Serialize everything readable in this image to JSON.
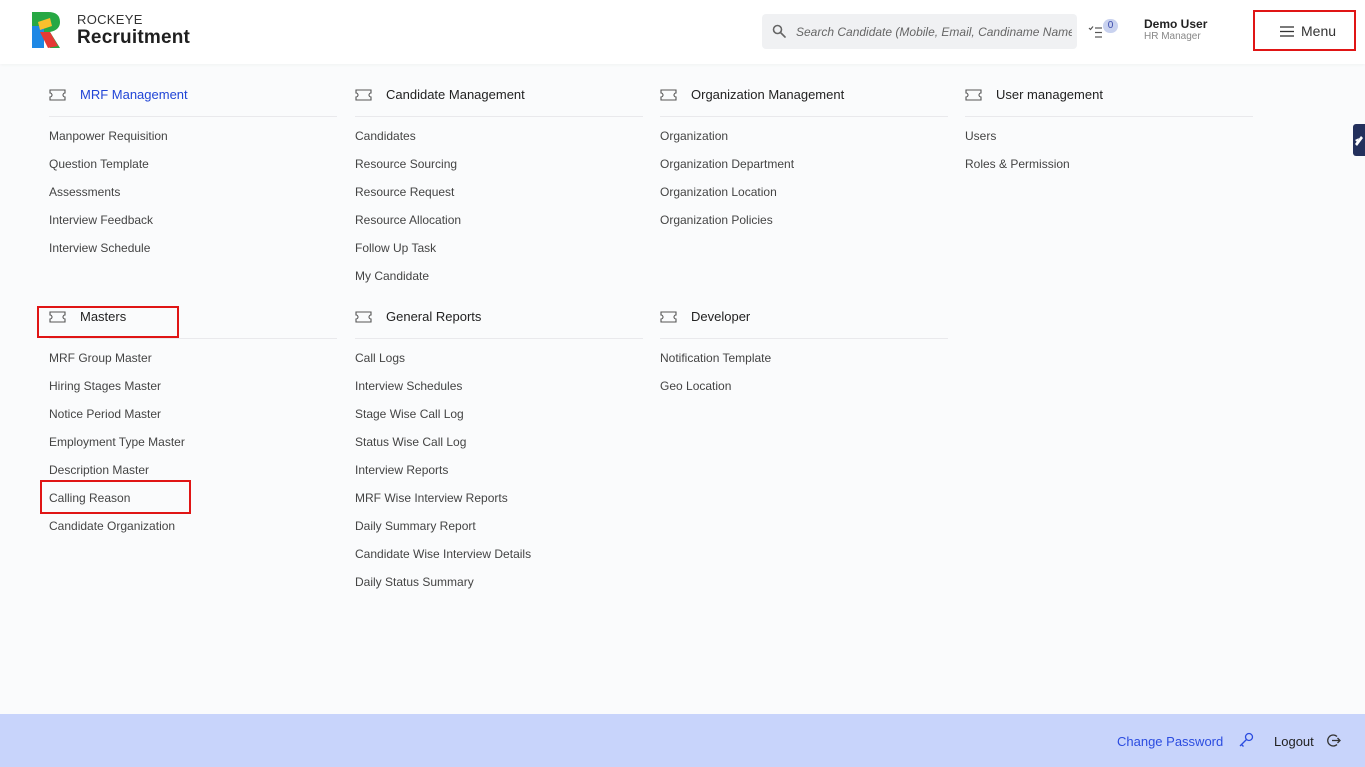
{
  "brand": {
    "line1": "ROCKEYE",
    "line2": "Recruitment"
  },
  "search": {
    "placeholder": "Search Candidate (Mobile, Email, Candiname Name)"
  },
  "tasks": {
    "count": "0"
  },
  "user": {
    "name": "Demo User",
    "role": "HR Manager"
  },
  "menu": {
    "label": "Menu"
  },
  "sections": [
    {
      "title": "MRF Management",
      "items": [
        "Manpower Requisition",
        "Question Template",
        "Assessments",
        "Interview Feedback",
        "Interview Schedule"
      ]
    },
    {
      "title": "Candidate Management",
      "items": [
        "Candidates",
        "Resource Sourcing",
        "Resource Request",
        "Resource Allocation",
        "Follow Up Task",
        "My Candidate"
      ]
    },
    {
      "title": "Organization Management",
      "items": [
        "Organization",
        "Organization Department",
        "Organization Location",
        "Organization Policies"
      ]
    },
    {
      "title": "User management",
      "items": [
        "Users",
        "Roles & Permission"
      ]
    },
    {
      "title": "Masters",
      "items": [
        "MRF Group Master",
        "Hiring Stages Master",
        "Notice Period Master",
        "Employment Type Master",
        "Description Master",
        "Calling Reason",
        "Candidate Organization"
      ]
    },
    {
      "title": "General Reports",
      "items": [
        "Call Logs",
        "Interview Schedules",
        "Stage Wise Call Log",
        "Status Wise Call Log",
        "Interview Reports",
        "MRF Wise Interview Reports",
        "Daily Summary Report",
        "Candidate Wise Interview Details",
        "Daily Status Summary"
      ]
    },
    {
      "title": "Developer",
      "items": [
        "Notification Template",
        "Geo Location"
      ]
    }
  ],
  "footer": {
    "change_password": "Change Password",
    "logout": "Logout"
  },
  "colors": {
    "accent": "#2145d6",
    "highlight": "#e01515",
    "footer_bg": "#c8d4fb",
    "link": "#2b4ce0"
  },
  "icons": [
    "search-icon",
    "task-list-icon",
    "hamburger-icon",
    "ticket-icon",
    "key-icon",
    "logout-icon"
  ]
}
